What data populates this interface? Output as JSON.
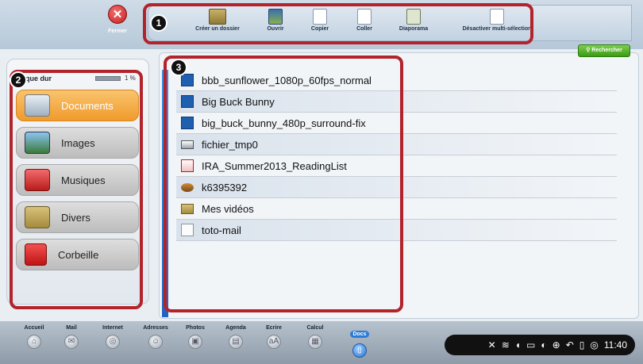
{
  "topbar": {
    "close_label": "Fermer",
    "toolbar": [
      {
        "label": "Créer un dossier",
        "icon": "new-folder-icon"
      },
      {
        "label": "Ouvrir",
        "icon": "open-icon"
      },
      {
        "label": "Copier",
        "icon": "copy-icon"
      },
      {
        "label": "Coller",
        "icon": "paste-icon"
      },
      {
        "label": "Diaporama",
        "icon": "slideshow-icon"
      },
      {
        "label": "Désactiver multi-sélection",
        "icon": "multi-select-icon"
      }
    ]
  },
  "search": {
    "label": "Rechercher"
  },
  "sidebar": {
    "title": "Disque dur",
    "usage": "1 %",
    "items": [
      {
        "label": "Documents",
        "active": true
      },
      {
        "label": "Images"
      },
      {
        "label": "Musiques"
      },
      {
        "label": "Divers"
      },
      {
        "label": "Corbeille"
      }
    ]
  },
  "files": [
    {
      "name": "bbb_sunflower_1080p_60fps_normal",
      "icon": "video-file-icon"
    },
    {
      "name": "Big Buck Bunny",
      "icon": "video-file-icon"
    },
    {
      "name": "big_buck_bunny_480p_surround-fix",
      "icon": "video-file-icon"
    },
    {
      "name": "fichier_tmp0",
      "icon": "mail-file-icon"
    },
    {
      "name": "IRA_Summer2013_ReadingList",
      "icon": "pdf-file-icon"
    },
    {
      "name": "k6395392",
      "icon": "audio-file-icon"
    },
    {
      "name": "Mes vidéos",
      "icon": "folder-icon"
    },
    {
      "name": "toto-mail",
      "icon": "text-file-icon"
    }
  ],
  "dock": [
    {
      "label": "Accueil",
      "glyph": "⌂"
    },
    {
      "label": "Mail",
      "glyph": "✉"
    },
    {
      "label": "Internet",
      "glyph": "◎"
    },
    {
      "label": "Adresses",
      "glyph": "☺"
    },
    {
      "label": "Photos",
      "glyph": "▣"
    },
    {
      "label": "Agenda",
      "glyph": "▤"
    },
    {
      "label": "Ecrire",
      "glyph": "aA"
    },
    {
      "label": "Calcul",
      "glyph": "▦"
    },
    {
      "label": "Docs",
      "glyph": "▯",
      "active": true
    }
  ],
  "tray": {
    "time": "11:40"
  },
  "callouts": [
    "1",
    "2",
    "3"
  ],
  "colors": {
    "callout": "#b3232b",
    "accent": "#2c7bd8",
    "active_tab": "#f09a2c"
  }
}
